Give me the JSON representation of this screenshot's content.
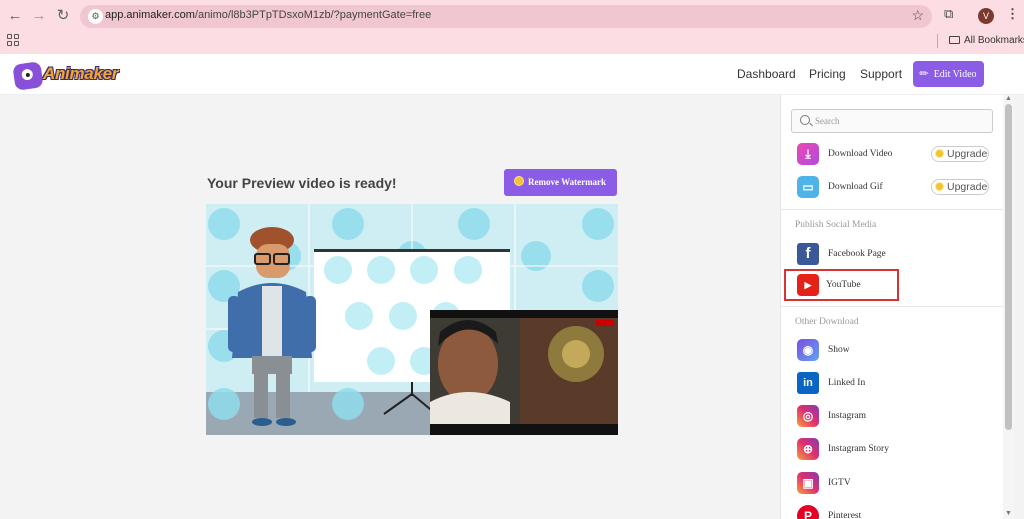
{
  "browser": {
    "url_host": "app.animaker.com",
    "url_path": "/animo/l8b3PTpTDsxoM1zb/?paymentGate=free",
    "profile_initial": "V",
    "bookmarks_label": "All Bookmarks"
  },
  "header": {
    "logo_text": "Animaker",
    "nav": [
      "Dashboard",
      "Pricing",
      "Support"
    ],
    "edit_button": "Edit Video"
  },
  "preview": {
    "title": "Your Preview video is ready!",
    "remove_watermark": "Remove Watermark"
  },
  "sidebar": {
    "search_placeholder": "Search",
    "downloads": [
      {
        "label": "Download Video",
        "upgrade": "Upgrade",
        "icon": "download-video-icon"
      },
      {
        "label": "Download Gif",
        "upgrade": "Upgrade",
        "icon": "download-gif-icon"
      }
    ],
    "publish_heading": "Publish Social Media",
    "publish": [
      {
        "label": "Facebook Page",
        "icon": "facebook-icon"
      },
      {
        "label": "YouTube",
        "icon": "youtube-icon"
      }
    ],
    "other_heading": "Other Download",
    "other": [
      {
        "label": "Show",
        "icon": "show-icon"
      },
      {
        "label": "Linked In",
        "icon": "linkedin-icon"
      },
      {
        "label": "Instagram",
        "icon": "instagram-icon"
      },
      {
        "label": "Instagram Story",
        "icon": "instagram-story-icon"
      },
      {
        "label": "IGTV",
        "icon": "igtv-icon"
      },
      {
        "label": "Pinterest",
        "icon": "pinterest-icon"
      }
    ]
  },
  "colors": {
    "accent": "#8b5ce6",
    "chrome_bg": "#fbdde3",
    "highlight": "#d63333"
  }
}
